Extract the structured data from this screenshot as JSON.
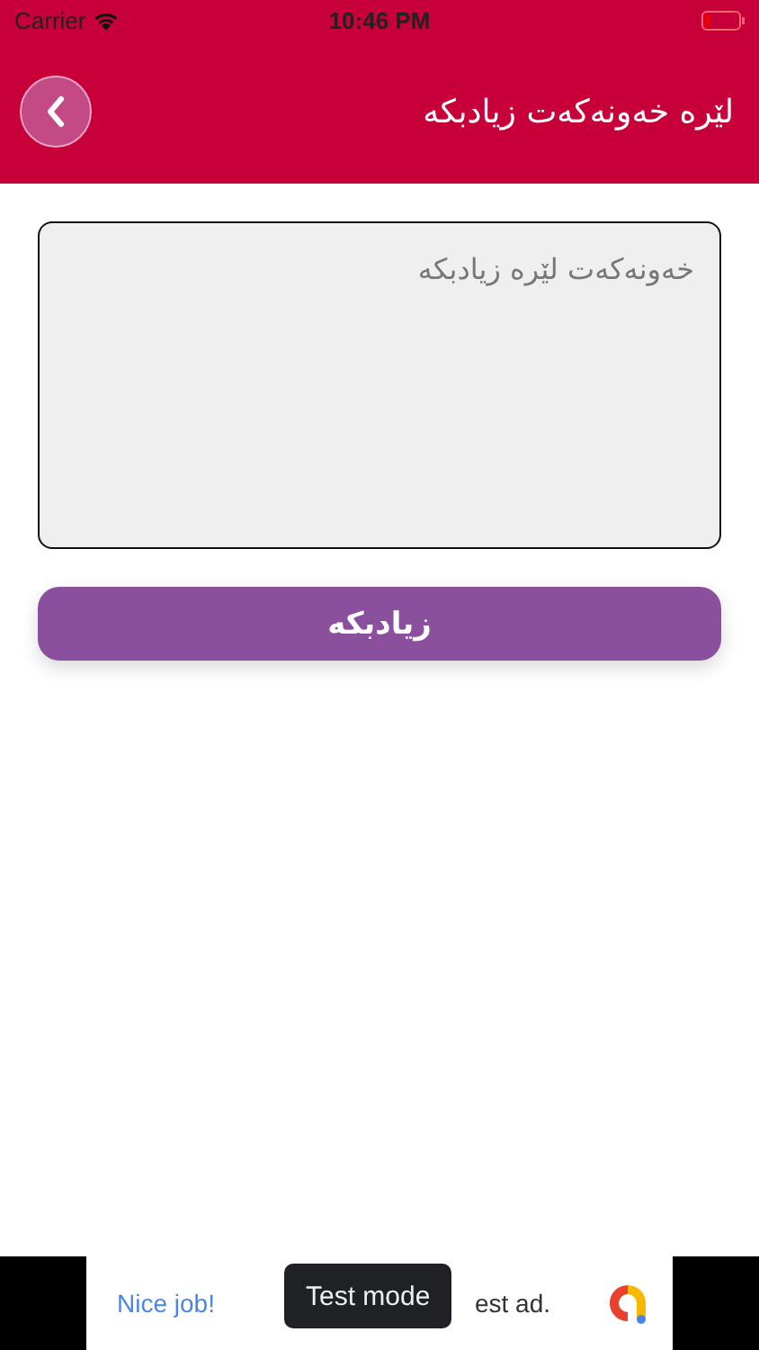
{
  "status_bar": {
    "carrier": "Carrier",
    "time": "10:46 PM"
  },
  "header": {
    "title": "لێرە خەونەکەت زیادبکە"
  },
  "form": {
    "placeholder": "خەونەکەت لێرە زیادبکە",
    "button": "زیادبکە"
  },
  "ad_banner": {
    "headline": "Nice job!",
    "body": "est ad.",
    "toast": "Test mode"
  }
}
